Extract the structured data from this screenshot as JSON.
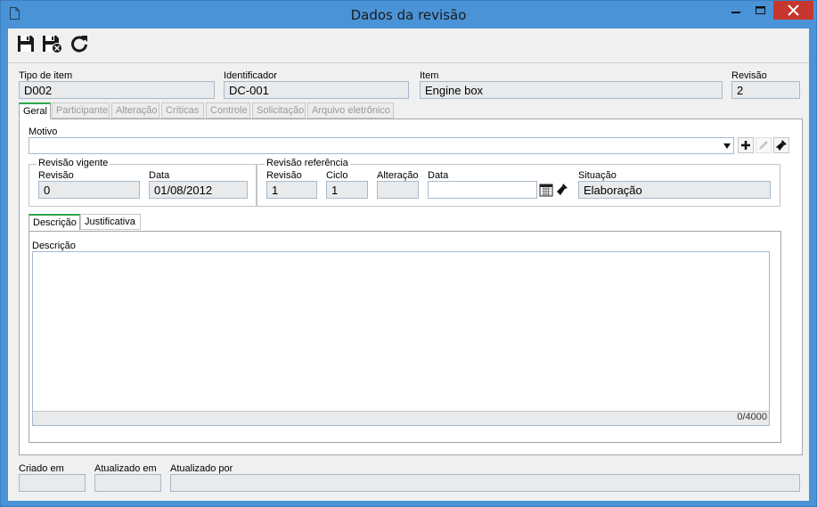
{
  "window": {
    "title": "Dados da revisão"
  },
  "header": {
    "tipo_label": "Tipo de item",
    "tipo_value": "D002",
    "ident_label": "Identificador",
    "ident_value": "DC-001",
    "item_label": "Item",
    "item_value": "Engine box",
    "revisao_label": "Revisão",
    "revisao_value": "2"
  },
  "tabs": [
    {
      "label": "Geral"
    },
    {
      "label": "Participante"
    },
    {
      "label": "Alteração"
    },
    {
      "label": "Críticas"
    },
    {
      "label": "Controle"
    },
    {
      "label": "Solicitação"
    },
    {
      "label": "Arquivo eletrônico"
    }
  ],
  "geral": {
    "motivo_label": "Motivo",
    "motivo_value": "",
    "vigente": {
      "legend": "Revisão vigente",
      "revisao_label": "Revisão",
      "revisao_value": "0",
      "data_label": "Data",
      "data_value": "01/08/2012"
    },
    "referencia": {
      "legend": "Revisão referência",
      "revisao_label": "Revisão",
      "revisao_value": "1",
      "ciclo_label": "Ciclo",
      "ciclo_value": "1",
      "alteracao_label": "Alteração",
      "alteracao_value": "",
      "data_label": "Data",
      "data_value": "",
      "situacao_label": "Situação",
      "situacao_value": "Elaboração"
    },
    "subtabs": [
      {
        "label": "Descrição"
      },
      {
        "label": "Justificativa"
      }
    ],
    "descricao_label": "Descrição",
    "descricao_value": "",
    "counter": "0/4000"
  },
  "footer": {
    "criado_label": "Criado em",
    "criado_value": "",
    "atualizado_label": "Atualizado em",
    "atualizado_value": "",
    "por_label": "Atualizado por",
    "por_value": ""
  },
  "icons": {
    "save": "floppy-disk-icon",
    "save_close": "save-and-close-icon",
    "refresh": "refresh-icon"
  }
}
